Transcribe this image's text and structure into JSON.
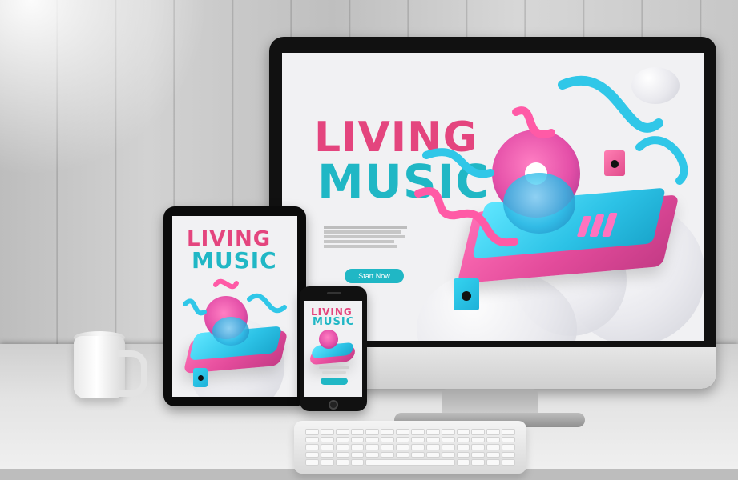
{
  "scene": {
    "background": {
      "wall_color": "#c9c9c9",
      "desk_color": "#e6e6e6"
    }
  },
  "brand": {
    "title_line_1": "LIVING",
    "title_line_2": "MUSIC"
  },
  "monitor": {
    "headline_1": "LIVING",
    "headline_2": "MUSIC",
    "cta_label": "Start Now"
  },
  "tablet": {
    "headline_1": "LIVING",
    "headline_2": "MUSIC"
  },
  "phone": {
    "headline_1": "LIVING",
    "headline_2": "MUSIC"
  },
  "colors": {
    "pink": "#e4457e",
    "cyan": "#20b7c5"
  }
}
